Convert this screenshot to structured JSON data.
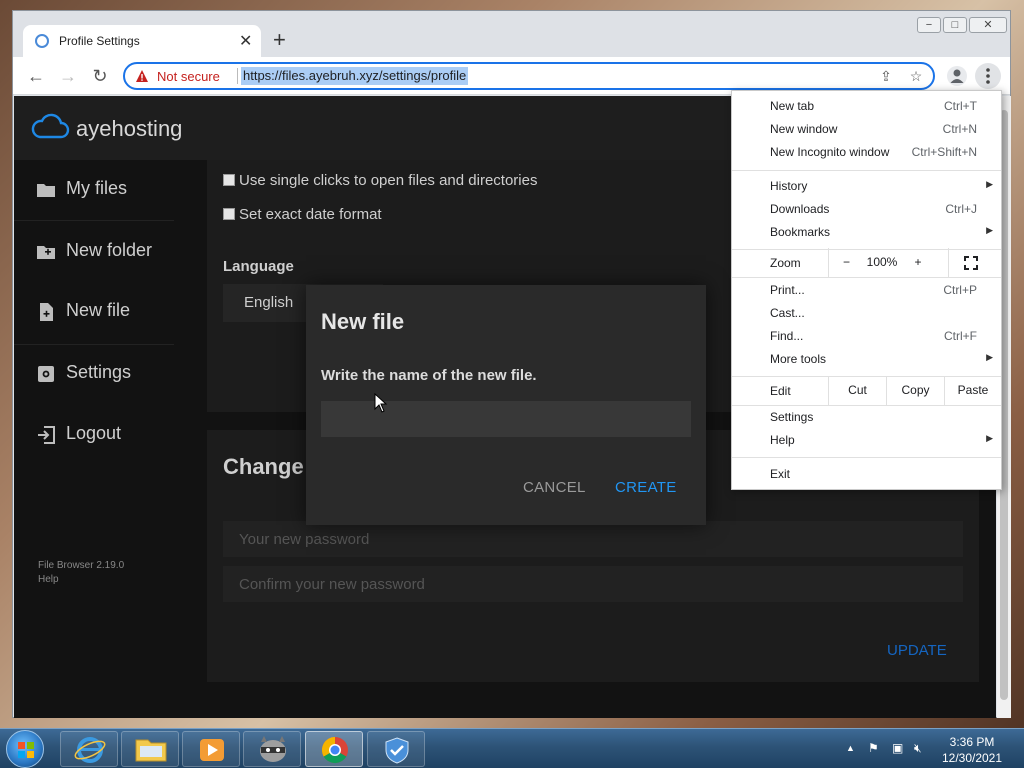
{
  "window": {
    "tab_title": "Profile Settings",
    "new_tab_symbol": "+",
    "controls": {
      "minimize": "−",
      "maximize": "□",
      "close": "✕"
    }
  },
  "toolbar": {
    "not_secure": "Not secure",
    "url": "https://files.ayebruh.xyz/settings/profile"
  },
  "app": {
    "brand": "ayehosting",
    "sidebar": {
      "items": [
        {
          "label": "My files",
          "icon": "folder-icon"
        },
        {
          "label": "New folder",
          "icon": "new-folder-icon"
        },
        {
          "label": "New file",
          "icon": "new-file-icon"
        },
        {
          "label": "Settings",
          "icon": "gear-icon"
        },
        {
          "label": "Logout",
          "icon": "logout-icon"
        }
      ],
      "version": "File Browser 2.19.0",
      "help": "Help"
    },
    "profile": {
      "single_clicks": "Use single clicks to open files and directories",
      "exact_date": "Set exact date format",
      "language_label": "Language",
      "language_value": "English"
    },
    "password": {
      "title": "Change",
      "new_placeholder": "Your new password",
      "confirm_placeholder": "Confirm your new password",
      "update": "UPDATE"
    }
  },
  "modal": {
    "title": "New file",
    "description": "Write the name of the new file.",
    "input_value": "",
    "cancel": "CANCEL",
    "create": "CREATE"
  },
  "menu": {
    "new_tab": {
      "label": "New tab",
      "shortcut": "Ctrl+T"
    },
    "new_window": {
      "label": "New window",
      "shortcut": "Ctrl+N"
    },
    "new_incognito": {
      "label": "New Incognito window",
      "shortcut": "Ctrl+Shift+N"
    },
    "history": {
      "label": "History"
    },
    "downloads": {
      "label": "Downloads",
      "shortcut": "Ctrl+J"
    },
    "bookmarks": {
      "label": "Bookmarks"
    },
    "zoom": {
      "label": "Zoom",
      "minus": "−",
      "value": "100%",
      "plus": "+"
    },
    "print": {
      "label": "Print...",
      "shortcut": "Ctrl+P"
    },
    "cast": {
      "label": "Cast..."
    },
    "find": {
      "label": "Find...",
      "shortcut": "Ctrl+F"
    },
    "more_tools": {
      "label": "More tools"
    },
    "edit": {
      "label": "Edit",
      "cut": "Cut",
      "copy": "Copy",
      "paste": "Paste"
    },
    "settings": {
      "label": "Settings"
    },
    "help": {
      "label": "Help"
    },
    "exit": {
      "label": "Exit"
    }
  },
  "taskbar": {
    "time": "3:36 PM",
    "date": "12/30/2021"
  },
  "colors": {
    "accent": "#2196f3",
    "update_button": "#1565c0"
  }
}
